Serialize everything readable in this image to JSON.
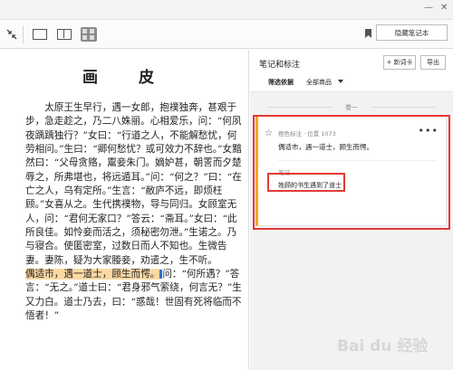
{
  "toolbar": {
    "notebook_button": "隐藏笔记本",
    "icons": [
      "collapse-arrows-icon",
      "single-page-icon",
      "two-page-icon",
      "grid-view-icon",
      "bookmark-icon"
    ]
  },
  "reader": {
    "title": "画　皮",
    "paragraph_before": "太原王生早行，遇一女郎，抱襆独奔，甚艰于步，急走趁之，乃二八姝丽。心相爱乐，问：“何夙夜踽踽独行？”女曰：“行道之人，不能解愁忧，何劳相问。”生曰：“卿何愁忧？或可效力不辞也。”女黯然曰：“父母贪赂，鬻妾朱门。嫡妒甚，朝詈而夕楚辱之，所弗堪也，将远遁耳。”问：“何之？”曰：“在亡之人，乌有定所。”生言：“敝庐不远，即烦枉顾。”女喜从之。生代携襆物，导与同归。女顾室无人，问：“君何无家口？”答云：“斋耳。”女曰：“此所良佳。如怜妾而活之，须秘密勿泄。”生诺之。乃与寝合。使匿密室，过数日而人不知也。生微告妻。妻陈，疑为大家媵妾，劝遣之，生不听。",
    "highlight": "偶适市，遇一道士，顾生而愕。",
    "paragraph_after": "问：“何所遇？”答言：“无之。”道士曰：“君身邪气萦绕，何言无？”生又力白。道士乃去，曰：“惑哉！世固有死将临而不悟者！”"
  },
  "notes_panel": {
    "title": "笔记和标注",
    "add_button": "+ 新词卡",
    "export_button": "导出",
    "filter_label": "筛选依据",
    "filter_value": "全部商品",
    "chapter": "卷一",
    "card": {
      "meta": "橙色标注 · 位置 1073",
      "quote": "偶适市，遇一道士，顾生而愕。",
      "note_label": "笔记",
      "note_text": "姓顾的书生遇到了道士"
    }
  },
  "watermark": "Bai du 经验",
  "colors": {
    "highlight": "#fbd9a3",
    "accent_orange": "#f6a623",
    "annotation_red": "#e53935"
  }
}
